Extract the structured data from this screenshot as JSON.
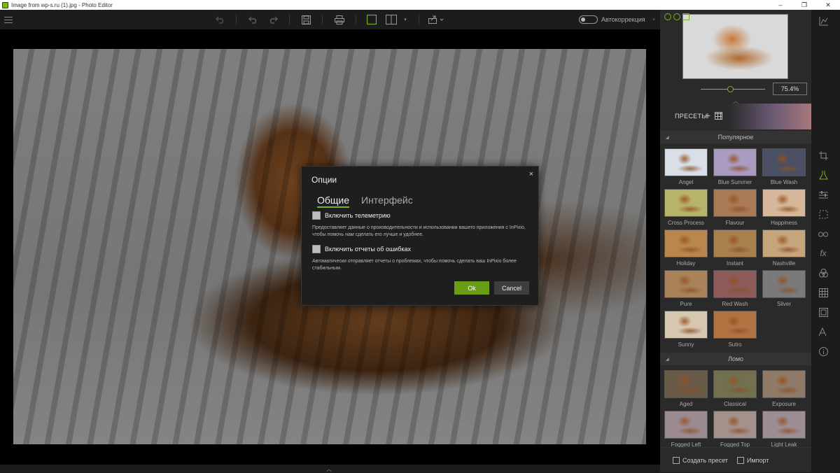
{
  "window": {
    "title": "Image from wp-s.ru (1).jpg - Photo Editor",
    "minimize": "–",
    "maximize": "❐",
    "close": "✕"
  },
  "toolbar": {
    "autocorrection_label": "Автокоррекция"
  },
  "navigator": {
    "zoom_value": "75.4%"
  },
  "presets": {
    "header_label": "ПРЕСЕТЫ",
    "sections": [
      {
        "title": "Популярное",
        "items": [
          {
            "label": "Angel",
            "tint": "#d8dfe6"
          },
          {
            "label": "Blue Summer",
            "tint": "#a99cc0"
          },
          {
            "label": "Blue Wash",
            "tint": "#4a4f63"
          },
          {
            "label": "Cross Process",
            "tint": "#b8b36a"
          },
          {
            "label": "Flavour",
            "tint": "#a87a55"
          },
          {
            "label": "Happiness",
            "tint": "#d7b79a"
          },
          {
            "label": "Holiday",
            "tint": "#b9874e"
          },
          {
            "label": "Instant",
            "tint": "#a8814f"
          },
          {
            "label": "Nashville",
            "tint": "#c7a57c"
          },
          {
            "label": "Pure",
            "tint": "#a98259"
          },
          {
            "label": "Red Wash",
            "tint": "#8c5a59"
          },
          {
            "label": "Silver",
            "tint": "#7a7a7a"
          },
          {
            "label": "Sunny",
            "tint": "#d6c7b0"
          },
          {
            "label": "Sutro",
            "tint": "#b27343"
          }
        ]
      },
      {
        "title": "Ломо",
        "items": [
          {
            "label": "Aged",
            "tint": "#6a5a48"
          },
          {
            "label": "Classical",
            "tint": "#72704e"
          },
          {
            "label": "Exposure",
            "tint": "#8e7a66"
          },
          {
            "label": "Fogged Left",
            "tint": "#9c8a93"
          },
          {
            "label": "Fogged Top",
            "tint": "#a3918c"
          },
          {
            "label": "Light Leak",
            "tint": "#9d8e95"
          }
        ]
      }
    ],
    "create_label": "Создать пресет",
    "import_label": "Импорт"
  },
  "dialog": {
    "title": "Опции",
    "close": "×",
    "tabs": [
      "Общие",
      "Интерфейс"
    ],
    "telemetry_label": "Включить телеметрию",
    "telemetry_desc": "Предоставляет данные о производительности и использовании вашего приложения с InPixio, чтобы помочь нам сделать его лучше и удобнее.",
    "errors_label": "Включить отчеты об ошибках",
    "errors_desc": "Автоматически отправляет отчеты о проблемах, чтобы помочь сделать ваш InPixio более стабильным.",
    "ok_label": "Ok",
    "cancel_label": "Cancel"
  },
  "colors": {
    "accent": "#7ab51d",
    "ok_button": "#6b9c15"
  }
}
